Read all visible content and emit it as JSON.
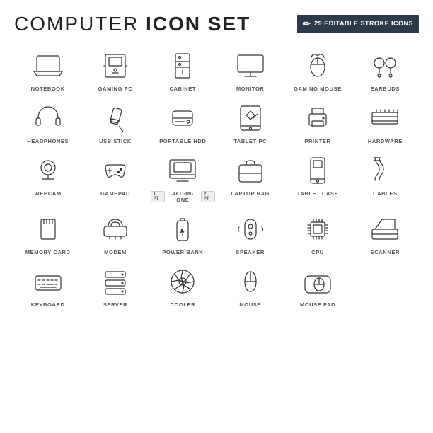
{
  "header": {
    "title_pre": "COMPUTER ",
    "title_bold": "ICON SET",
    "badge": {
      "count": "29",
      "line1": "EDITABLE STROKE ICONS"
    }
  },
  "icons": [
    {
      "id": "notebook",
      "label": "NOTEBOOK"
    },
    {
      "id": "gaming-pc",
      "label": "GAMING PC"
    },
    {
      "id": "cabinet",
      "label": "CABINET"
    },
    {
      "id": "monitor",
      "label": "MONITOR"
    },
    {
      "id": "gaming-mouse",
      "label": "GAMING MOUSE"
    },
    {
      "id": "earbuds",
      "label": "EARBUDS"
    },
    {
      "id": "headphones",
      "label": "HEADPHONES"
    },
    {
      "id": "usb-stick",
      "label": "USB STICK"
    },
    {
      "id": "portable-hdd",
      "label": "PORTABLE HDD"
    },
    {
      "id": "tablet-pc",
      "label": "TABLET PC"
    },
    {
      "id": "printer",
      "label": "PRINTER"
    },
    {
      "id": "hardware",
      "label": "HARDWARE"
    },
    {
      "id": "webcam",
      "label": "WEBCAM"
    },
    {
      "id": "gamepad",
      "label": "GAMEPAD"
    },
    {
      "id": "all-in-one",
      "label": "ALL-IN-ONE"
    },
    {
      "id": "laptop-bag",
      "label": "LAPTOP BAG"
    },
    {
      "id": "tablet-case",
      "label": "TABLET CASE"
    },
    {
      "id": "cables",
      "label": "CABLES"
    },
    {
      "id": "memory-card",
      "label": "MEMORY CARD"
    },
    {
      "id": "modem",
      "label": "MODEM"
    },
    {
      "id": "power-bank",
      "label": "POWER BANK"
    },
    {
      "id": "speaker",
      "label": "SPEAKER"
    },
    {
      "id": "cpu",
      "label": "CPU"
    },
    {
      "id": "scanner",
      "label": "SCANNER"
    },
    {
      "id": "keyboard",
      "label": "KEYBOARD"
    },
    {
      "id": "server",
      "label": "SERVER"
    },
    {
      "id": "cooler",
      "label": "COOLER"
    },
    {
      "id": "mouse",
      "label": "MOUSE"
    },
    {
      "id": "mouse-pad",
      "label": "MOUSE PAD"
    }
  ]
}
